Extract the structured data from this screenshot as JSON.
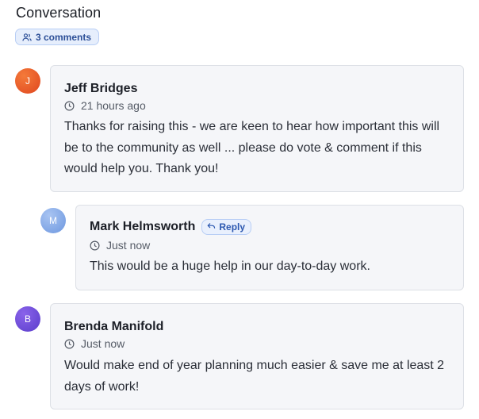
{
  "header": {
    "title": "Conversation",
    "comments_badge": "3 comments"
  },
  "comments": [
    {
      "avatar_initial": "J",
      "author": "Jeff Bridges",
      "time": "21 hours ago",
      "text": "Thanks for raising this - we are keen to hear how important this will be to the community as well ... please do vote & comment if this would help you. Thank you!"
    },
    {
      "avatar_initial": "M",
      "author": "Mark Helmsworth",
      "reply_label": "Reply",
      "time": "Just now",
      "text": "This would be a huge help in our day-to-day work."
    },
    {
      "avatar_initial": "B",
      "author": "Brenda Manifold",
      "time": "Just now",
      "text": "Would make end of year planning much easier & save me at least 2 days of work!"
    }
  ],
  "colors": {
    "avatar_j": "#e8532a",
    "avatar_m": "#7ba4e6",
    "avatar_b": "#6a4fd6",
    "accent": "#2c58b0"
  }
}
